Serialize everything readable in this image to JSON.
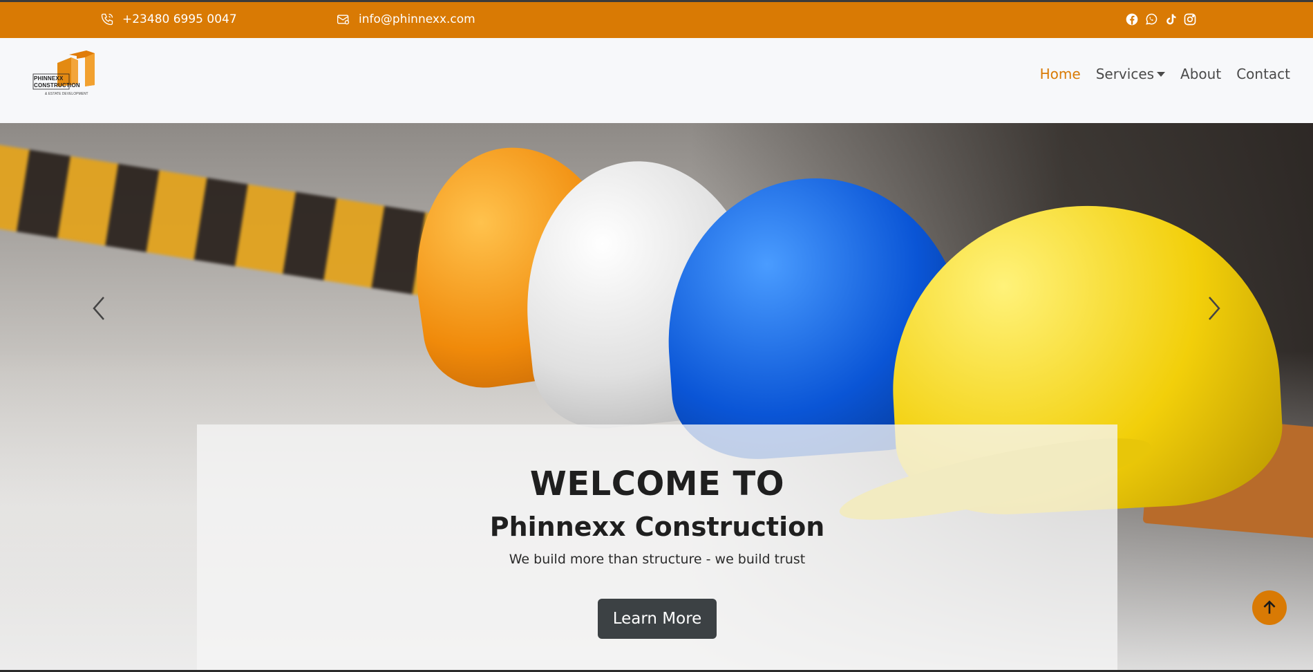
{
  "topbar": {
    "phone": "+23480 6995 0047",
    "email": "info@phinnexx.com",
    "socials": [
      "facebook-icon",
      "whatsapp-icon",
      "tiktok-icon",
      "instagram-icon"
    ],
    "bg_color": "#d97a04"
  },
  "logo": {
    "line1": "PHINNEXX",
    "line2": "CONSTRUCTION",
    "sub": "& ESTATE DEVELOPMENT"
  },
  "nav": {
    "home": "Home",
    "services": "Services",
    "about": "About",
    "contact": "Contact",
    "active": "Home",
    "accent": "#d97a04"
  },
  "hero": {
    "heading": "WELCOME TO",
    "subheading": "Phinnexx Construction",
    "tagline": "We build more than structure - we build trust",
    "button": "Learn More"
  },
  "colors": {
    "button_bg": "#3c4144",
    "scroll_top_bg": "#d97a04"
  }
}
